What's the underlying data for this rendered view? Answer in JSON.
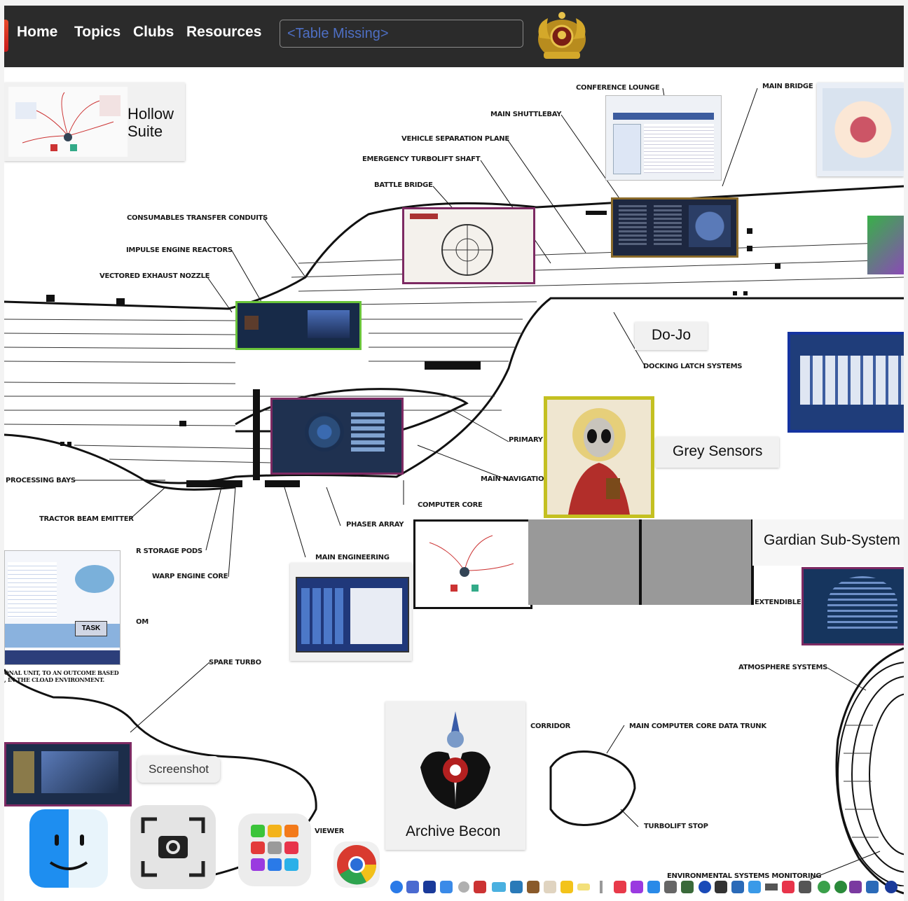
{
  "navbar": {
    "links": [
      "Home",
      "Topics",
      "Clubs",
      "Resources"
    ],
    "search_placeholder": "<Table Missing>"
  },
  "tiles": {
    "hollow_suite": "Hollow\nSuite",
    "dojo": "Do-Jo",
    "grey_sensors": "Grey Sensors",
    "gardian": "Gardian Sub-System",
    "archive": "Archive Becon"
  },
  "callouts": {
    "conference_lounge": "CONFERENCE LOUNGE",
    "main_bridge": "MAIN BRIDGE",
    "main_shuttlebay": "MAIN SHUTTLEBAY",
    "vehicle_separation_plane": "VEHICLE SEPARATION PLANE",
    "emergency_turbolift_shaft": "EMERGENCY TURBOLIFT SHAFT",
    "battle_bridge": "BATTLE BRIDGE",
    "consumables": "CONSUMABLES TRANSFER CONDUITS",
    "impulse": "IMPULSE ENGINE REACTORS",
    "vectored": "VECTORED EXHAUST NOZZLE",
    "docking_latch": "DOCKING LATCH SYSTEMS",
    "primary": "PRIMARY",
    "main_navigation": "MAIN NAVIGATION",
    "processing_bays": "PROCESSING BAYS",
    "computer_core": "COMPUTER CORE",
    "tractor": "TRACTOR BEAM EMITTER",
    "phaser": "PHASER ARRAY",
    "storage_pods": "R STORAGE PODS",
    "main_engineering": "MAIN ENGINEERING",
    "warp_core": "WARP ENGINE CORE",
    "extendible": "EXTENDIBLE",
    "om": "OM",
    "spare_turbo": "SPARE TURBO",
    "atmosphere": "ATMOSPHERE SYSTEMS",
    "corridor": "CORRIDOR",
    "main_computer_trunk": "MAIN COMPUTER CORE DATA TRUNK",
    "turbolift_stop": "TURBOLIFT STOP",
    "viewer": "VIEWER",
    "environmental": "ENVIRONMENTAL SYSTEMS MONITORING",
    "outcome_line1": "ONAL UNIT, TO AN OUTCOME BASED",
    "outcome_line2": ", IN THE CLOAD ENVIRONMENT."
  },
  "diagram_labels": {
    "task_button": "TASK"
  },
  "dock": {
    "tooltip": "Screenshot",
    "icons": [
      "finder-icon",
      "screenshot-icon",
      "launchpad-icon",
      "chrome-icon"
    ]
  },
  "colors": {
    "navbar": "#2b2b2b",
    "search_text": "#4e6fc4",
    "frame_purple": "#7d2a63",
    "frame_yellow": "#c4c021",
    "frame_blue": "#1a3a9a"
  }
}
